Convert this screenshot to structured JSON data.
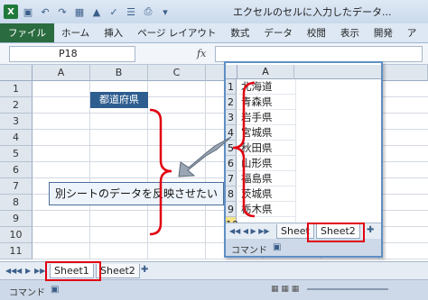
{
  "window": {
    "title": "エクセルのセルに入力したデータ...",
    "quick_access": [
      "save-icon",
      "undo-icon",
      "redo-icon",
      "borders-icon",
      "fill-color-icon",
      "format-painter-icon",
      "paste-special-icon",
      "print-preview-icon",
      "filter-icon",
      "other-icon"
    ]
  },
  "ribbon": {
    "tabs": [
      "ファイル",
      "ホーム",
      "挿入",
      "ページ レイアウト",
      "数式",
      "データ",
      "校閲",
      "表示",
      "開発",
      "ア"
    ]
  },
  "formula_bar": {
    "name_box": "P18",
    "fx_label": "fx",
    "value": ""
  },
  "main_sheet": {
    "columns": [
      "A",
      "B",
      "C"
    ],
    "rows": [
      "1",
      "2",
      "3",
      "4",
      "5",
      "6",
      "7",
      "8",
      "9",
      "10",
      "11"
    ],
    "b1_value": "都道府県",
    "sheet_tabs": [
      "Sheet1",
      "Sheet2"
    ],
    "active_tab": "Sheet1",
    "status": "コマンド"
  },
  "second_window": {
    "column": "A",
    "rows": [
      "1",
      "2",
      "3",
      "4",
      "5",
      "6",
      "7",
      "8",
      "9",
      "10"
    ],
    "values": [
      "北海道",
      "青森県",
      "岩手県",
      "宮城県",
      "秋田県",
      "山形県",
      "福島県",
      "茨城県",
      "栃木県",
      ""
    ],
    "sheet_tabs": [
      "Sheet",
      "Sheet2"
    ],
    "active_tab": "Sheet2",
    "status": "コマンド"
  },
  "callout": {
    "text": "別シートのデータを反映させたい"
  },
  "colors": {
    "highlight_cell": "#2e5d8f",
    "annotation_red": "#e00010",
    "file_tab": "#2a6b3f"
  }
}
